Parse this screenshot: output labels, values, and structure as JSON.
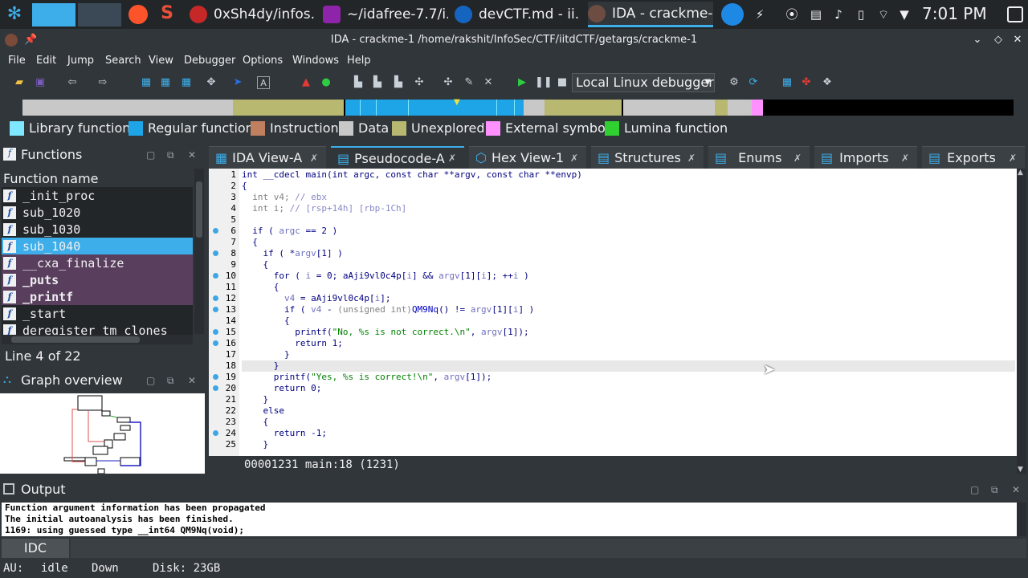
{
  "taskbar": {
    "tasks": [
      {
        "label": "0xSh4dy/infos...",
        "color": "#c62828"
      },
      {
        "label": "~/idafree-7.7/i...",
        "color": "#8e24aa"
      },
      {
        "label": "devCTF.md - ii...",
        "color": "#1565c0"
      },
      {
        "label": "IDA - crackme-...",
        "color": "#6d4c41"
      }
    ],
    "clock": "7:01 PM"
  },
  "window": {
    "title": "IDA - crackme-1 /home/rakshit/InfoSec/CTF/iitdCTF/getargs/crackme-1"
  },
  "menu": [
    "File",
    "Edit",
    "Jump",
    "Search",
    "View",
    "Debugger",
    "Options",
    "Windows",
    "Help"
  ],
  "toolbar": {
    "debugger_select": "Local Linux debugger"
  },
  "legend": [
    {
      "label": "Library function",
      "color": "#7fe8ff"
    },
    {
      "label": "Regular function",
      "color": "#1ea5e8"
    },
    {
      "label": "Instruction",
      "color": "#c08060"
    },
    {
      "label": "Data",
      "color": "#c8c8c8"
    },
    {
      "label": "Unexplored",
      "color": "#b8b870"
    },
    {
      "label": "External symbol",
      "color": "#ff90ff"
    },
    {
      "label": "Lumina function",
      "color": "#30d030"
    }
  ],
  "functions_panel": {
    "title": "Functions",
    "column_header": "Function name",
    "items": [
      {
        "name": "_init_proc"
      },
      {
        "name": "sub_1020"
      },
      {
        "name": "sub_1030"
      },
      {
        "name": "sub_1040"
      },
      {
        "name": "__cxa_finalize"
      },
      {
        "name": "_puts"
      },
      {
        "name": "_printf"
      },
      {
        "name": "_start"
      },
      {
        "name": "deregister_tm_clones"
      }
    ],
    "line_status": "Line 4 of 22"
  },
  "graph_overview": {
    "title": "Graph overview"
  },
  "tabs": [
    {
      "label": "IDA View-A"
    },
    {
      "label": "Pseudocode-A"
    },
    {
      "label": "Hex View-1"
    },
    {
      "label": "Structures"
    },
    {
      "label": "Enums"
    },
    {
      "label": "Imports"
    },
    {
      "label": "Exports"
    }
  ],
  "code": {
    "line_numbers": [
      "1",
      "2",
      "3",
      "4",
      "5",
      "6",
      "7",
      "8",
      "9",
      "10",
      "11",
      "12",
      "13",
      "14",
      "15",
      "16",
      "17",
      "18",
      "19",
      "20",
      "21",
      "22",
      "23",
      "24",
      "25"
    ],
    "lines": {
      "l1": "int __cdecl main(int argc, const char **argv, const char **envp)",
      "l2": "{",
      "l3a": "  int v4; ",
      "l3b": "// ebx",
      "l4a": "  int i; ",
      "l4b": "// [rsp+14h] [rbp-1Ch]",
      "l6a": "  if ( ",
      "l6b": "argc",
      "l6c": " == 2 )",
      "l7": "  {",
      "l8a": "    if ( *",
      "l8b": "argv",
      "l8c": "[1] )",
      "l9": "    {",
      "l10a": "      for ( ",
      "l10b": "i",
      "l10c": " = 0; aAji9vl0c4p[",
      "l10d": "i",
      "l10e": "] && ",
      "l10f": "argv",
      "l10g": "[1][",
      "l10h": "i",
      "l10i": "]; ++",
      "l10j": "i",
      "l10k": " )",
      "l11": "      {",
      "l12a": "        v4",
      "l12b": " = aAji9vl0c4p[",
      "l12c": "i",
      "l12d": "];",
      "l13a": "        if ( ",
      "l13b": "v4",
      "l13c": " - ",
      "l13d": "(unsigned int)",
      "l13e": "QM9Nq",
      "l13f": "() != ",
      "l13g": "argv",
      "l13h": "[1][",
      "l13i": "i",
      "l13j": "] )",
      "l14": "        {",
      "l15a": "          printf(",
      "l15b": "\"No, %s is not correct.\\n\"",
      "l15c": ", ",
      "l15d": "argv",
      "l15e": "[1]);",
      "l16": "          return 1;",
      "l17": "        }",
      "l18": "      }",
      "l19a": "      printf(",
      "l19b": "\"Yes, %s is correct!\\n\"",
      "l19c": ", ",
      "l19d": "argv",
      "l19e": "[1]);",
      "l20": "      return 0;",
      "l21": "    }",
      "l22": "    else",
      "l23": "    {",
      "l24": "      return -1;",
      "l25": "    }"
    },
    "status": "00001231 main:18 (1231)"
  },
  "output": {
    "title": "Output",
    "lines": [
      "Function argument information has been propagated",
      "The initial autoanalysis has been finished.",
      "1169: using guessed type __int64 QM9Nq(void);"
    ],
    "input_lang": "IDC"
  },
  "statusbar": {
    "au": "AU:",
    "state": "idle",
    "direction": "Down",
    "disk": "Disk: 23GB"
  }
}
